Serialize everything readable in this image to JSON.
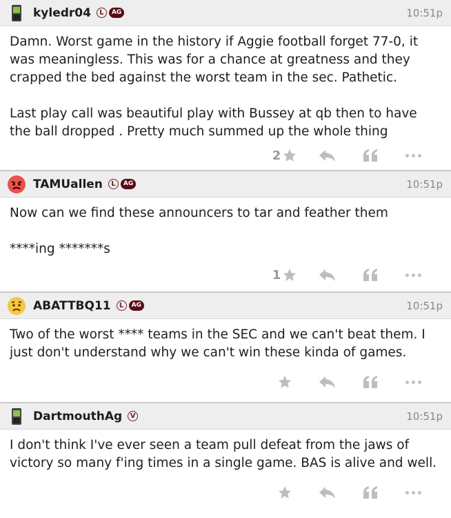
{
  "posts": [
    {
      "username": "kyledr04",
      "avatar": "phone-icon",
      "badges": {
        "l": "L",
        "ag": "AG"
      },
      "time": "10:51p",
      "paragraphs": [
        "Damn. Worst game in the history if Aggie football forget 77-0, it was meaningless. This was for a chance at greatness and they crapped the bed against the worst team in the sec. Pathetic.",
        "Last play call was beautiful play with Bussey at qb then to have the ball dropped . Pretty much summed up the whole thing"
      ],
      "stars": "2"
    },
    {
      "username": "TAMUallen",
      "avatar": "angry-face-icon",
      "badges": {
        "l": "L",
        "ag": "AG"
      },
      "time": "10:51p",
      "paragraphs": [
        "Now can we find these announcers to tar and feather them",
        "****ing *******s"
      ],
      "stars": "1"
    },
    {
      "username": "ABATTBQ11",
      "avatar": "worried-face-icon",
      "badges": {
        "l": "L",
        "ag": "AG"
      },
      "time": "10:51p",
      "paragraphs": [
        "Two of the worst **** teams in the SEC and we can't beat them. I just don't understand why we can't win these kinda of games."
      ],
      "stars": ""
    },
    {
      "username": "DartmouthAg",
      "avatar": "phone-icon",
      "badges": {
        "v": "V"
      },
      "time": "10:51p",
      "paragraphs": [
        "I don't think I've ever seen a team pull defeat from the jaws of victory so many f'ing times in a single game. BAS is alive and well."
      ],
      "stars": ""
    }
  ],
  "colors": {
    "maroon": "#5a0b14",
    "header_bg": "#eeeeee",
    "icon_gray": "#bdbdbd"
  }
}
